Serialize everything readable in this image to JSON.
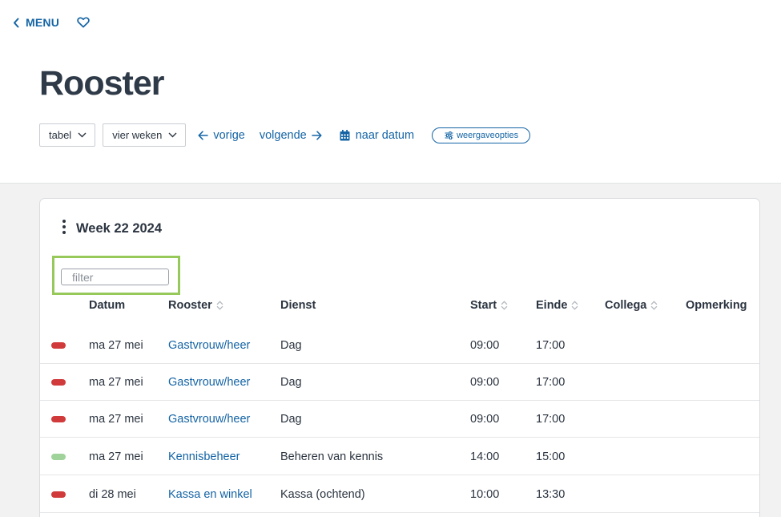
{
  "nav": {
    "menu_label": "MENU"
  },
  "page": {
    "title": "Rooster"
  },
  "toolbar": {
    "view_select": "tabel",
    "period_select": "vier weken",
    "prev_label": "vorige",
    "next_label": "volgende",
    "date_label": "naar datum",
    "options_label": "weergaveopties"
  },
  "week": {
    "title": "Week 22 2024"
  },
  "filter": {
    "placeholder": "filter",
    "value": ""
  },
  "table": {
    "headers": {
      "datum": "Datum",
      "rooster": "Rooster",
      "dienst": "Dienst",
      "start": "Start",
      "einde": "Einde",
      "collega": "Collega",
      "opmerking": "Opmerking"
    },
    "rows": [
      {
        "status_color": "#d13a3a",
        "datum": "ma 27 mei",
        "rooster": "Gastvrouw/heer",
        "dienst": "Dag",
        "start": "09:00",
        "einde": "17:00",
        "collega": "",
        "opmerking": ""
      },
      {
        "status_color": "#d13a3a",
        "datum": "ma 27 mei",
        "rooster": "Gastvrouw/heer",
        "dienst": "Dag",
        "start": "09:00",
        "einde": "17:00",
        "collega": "",
        "opmerking": ""
      },
      {
        "status_color": "#d13a3a",
        "datum": "ma 27 mei",
        "rooster": "Gastvrouw/heer",
        "dienst": "Dag",
        "start": "09:00",
        "einde": "17:00",
        "collega": "",
        "opmerking": ""
      },
      {
        "status_color": "#9fd39a",
        "datum": "ma 27 mei",
        "rooster": "Kennisbeheer",
        "dienst": "Beheren van kennis",
        "start": "14:00",
        "einde": "15:00",
        "collega": "",
        "opmerking": ""
      },
      {
        "status_color": "#d13a3a",
        "datum": "di 28 mei",
        "rooster": "Kassa en winkel",
        "dienst": "Kassa (ochtend)",
        "start": "10:00",
        "einde": "13:30",
        "collega": "",
        "opmerking": ""
      }
    ]
  },
  "colors": {
    "accent": "#1464a5",
    "highlight": "#96c85a",
    "band": "#f2f2f2"
  },
  "icons": [
    "chevron-left-icon",
    "heart-icon",
    "chevron-down-icon",
    "arrow-left-icon",
    "arrow-right-icon",
    "calendar-icon",
    "sliders-icon",
    "kebab-icon",
    "sort-icon"
  ]
}
